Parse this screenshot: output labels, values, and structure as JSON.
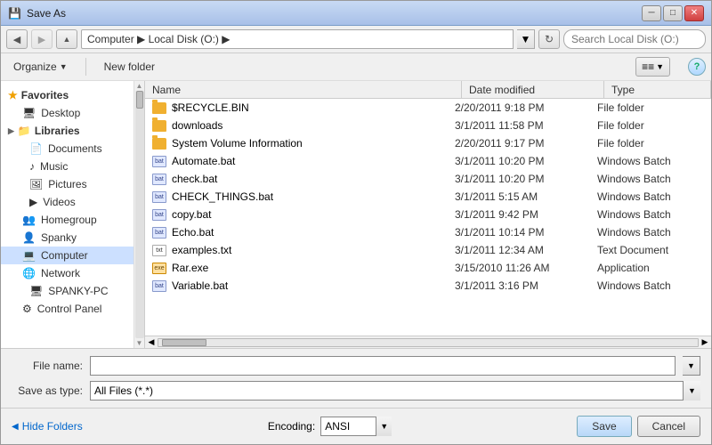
{
  "window": {
    "title": "Save As",
    "icon": "💾"
  },
  "titlebar": {
    "buttons": {
      "minimize": "─",
      "maximize": "□",
      "close": "✕"
    }
  },
  "addressbar": {
    "path": "Computer ▶ Local Disk (O:) ▶",
    "search_placeholder": "Search Local Disk (O:)"
  },
  "toolbar": {
    "organize_label": "Organize",
    "new_folder_label": "New folder",
    "views_icon": "≡",
    "help_icon": "?"
  },
  "left_panel": {
    "sections": [
      {
        "type": "header",
        "label": "Favorites",
        "icon": "★"
      },
      {
        "type": "item",
        "label": "Desktop",
        "icon": "🖥",
        "indent": 0
      },
      {
        "type": "header",
        "label": "Libraries",
        "icon": "📁",
        "indent": 0
      },
      {
        "type": "item",
        "label": "Documents",
        "icon": "📄",
        "indent": 1
      },
      {
        "type": "item",
        "label": "Music",
        "icon": "♪",
        "indent": 1
      },
      {
        "type": "item",
        "label": "Pictures",
        "icon": "🖼",
        "indent": 1
      },
      {
        "type": "item",
        "label": "Videos",
        "icon": "▶",
        "indent": 1
      },
      {
        "type": "item",
        "label": "Homegroup",
        "icon": "👥",
        "indent": 0
      },
      {
        "type": "item",
        "label": "Spanky",
        "icon": "👤",
        "indent": 0
      },
      {
        "type": "item",
        "label": "Computer",
        "icon": "💻",
        "indent": 0,
        "selected": true
      },
      {
        "type": "item",
        "label": "Network",
        "icon": "🌐",
        "indent": 0
      },
      {
        "type": "item",
        "label": "SPANKY-PC",
        "icon": "🖥",
        "indent": 1
      },
      {
        "type": "item",
        "label": "Control Panel",
        "icon": "⚙",
        "indent": 0
      }
    ]
  },
  "file_list": {
    "columns": {
      "name": "Name",
      "date_modified": "Date modified",
      "type": "Type"
    },
    "items": [
      {
        "name": "$RECYCLE.BIN",
        "date": "2/20/2011 9:18 PM",
        "type": "File folder",
        "icon": "folder"
      },
      {
        "name": "downloads",
        "date": "3/1/2011 11:58 PM",
        "type": "File folder",
        "icon": "folder"
      },
      {
        "name": "System Volume Information",
        "date": "2/20/2011 9:17 PM",
        "type": "File folder",
        "icon": "folder"
      },
      {
        "name": "Automate.bat",
        "date": "3/1/2011 10:20 PM",
        "type": "Windows Batch",
        "icon": "bat"
      },
      {
        "name": "check.bat",
        "date": "3/1/2011 10:20 PM",
        "type": "Windows Batch",
        "icon": "bat"
      },
      {
        "name": "CHECK_THINGS.bat",
        "date": "3/1/2011 5:15 AM",
        "type": "Windows Batch",
        "icon": "bat"
      },
      {
        "name": "copy.bat",
        "date": "3/1/2011 9:42 PM",
        "type": "Windows Batch",
        "icon": "bat"
      },
      {
        "name": "Echo.bat",
        "date": "3/1/2011 10:14 PM",
        "type": "Windows Batch",
        "icon": "bat"
      },
      {
        "name": "examples.txt",
        "date": "3/1/2011 12:34 AM",
        "type": "Text Document",
        "icon": "txt"
      },
      {
        "name": "Rar.exe",
        "date": "3/15/2010 11:26 AM",
        "type": "Application",
        "icon": "exe"
      },
      {
        "name": "Variable.bat",
        "date": "3/1/2011 3:16 PM",
        "type": "Windows Batch",
        "icon": "bat"
      }
    ]
  },
  "bottom_form": {
    "filename_label": "File name:",
    "filename_value": "",
    "filetype_label": "Save as type:",
    "filetype_value": "All Files (*.*)"
  },
  "bottom_actions": {
    "hide_folders_label": "Hide Folders",
    "encoding_label": "Encoding:",
    "encoding_value": "ANSI",
    "save_label": "Save",
    "cancel_label": "Cancel"
  }
}
